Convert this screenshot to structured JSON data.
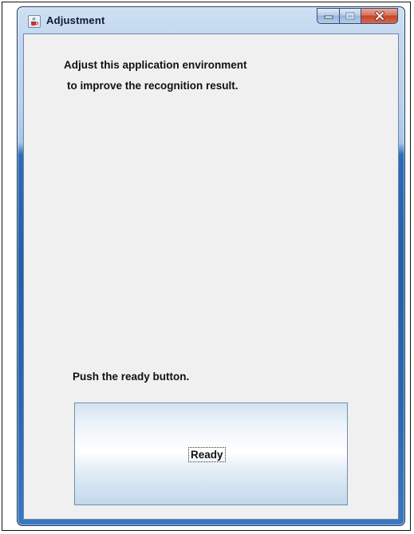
{
  "window": {
    "title": "Adjustment",
    "icon": "java-cup-icon",
    "caption_buttons": [
      "minimize-icon",
      "maximize-icon",
      "close-icon"
    ]
  },
  "content": {
    "message_line_1": "Adjust this application environment",
    "message_line_2": "to improve the recognition result.",
    "instruction": "Push the ready button.",
    "ready_button_label": "Ready"
  },
  "colors": {
    "content_background": "#f0f0f0",
    "titlebar": "#c2d7ef",
    "close_button": "#c6432a",
    "ready_button_top": "#d4e3f1",
    "ready_button_bottom": "#c3d8ec"
  }
}
